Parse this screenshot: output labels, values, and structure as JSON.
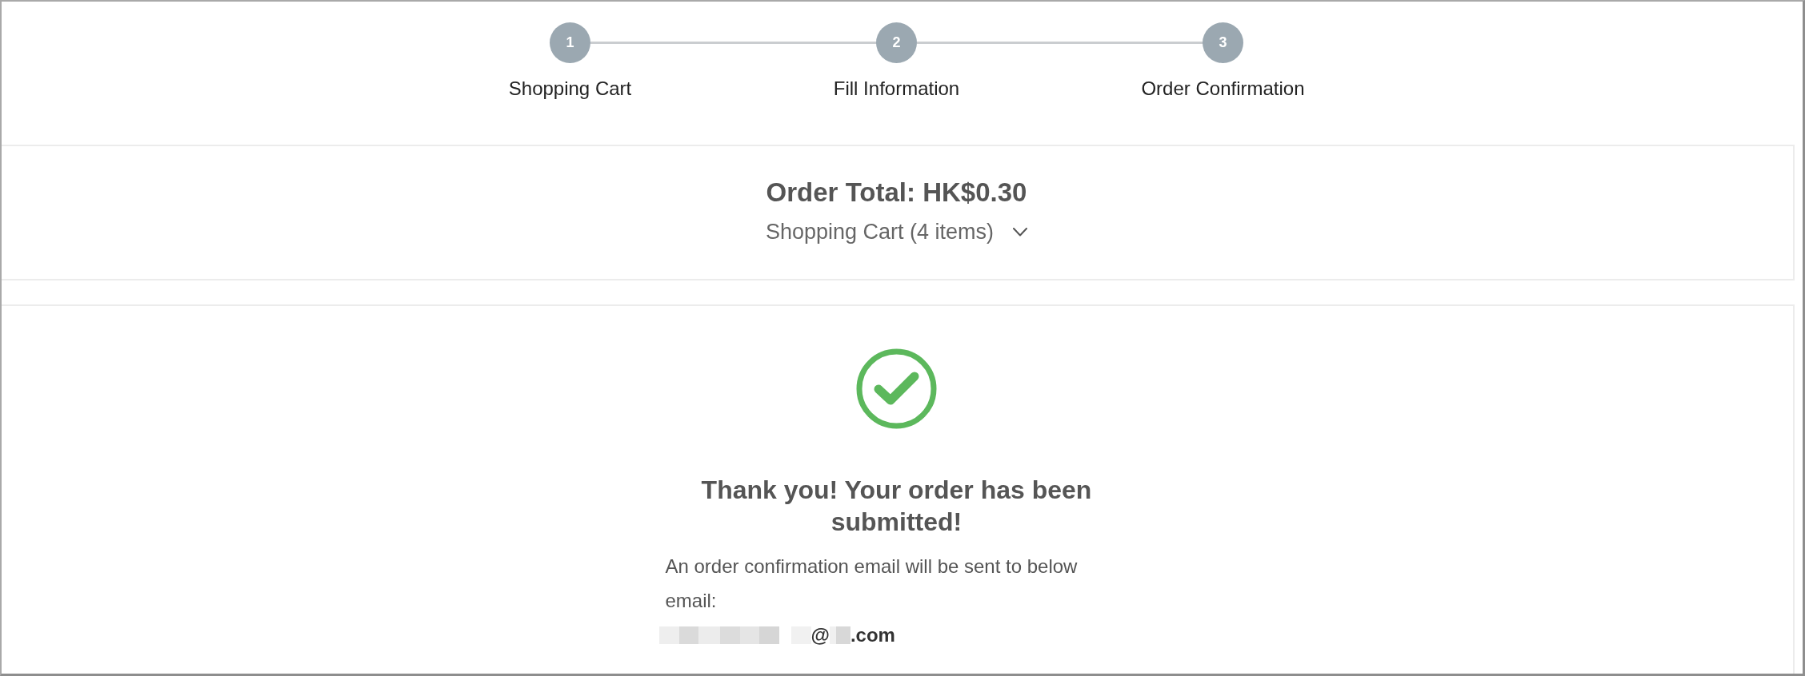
{
  "steps": [
    {
      "number": "1",
      "label": "Shopping Cart"
    },
    {
      "number": "2",
      "label": "Fill Information"
    },
    {
      "number": "3",
      "label": "Order Confirmation"
    }
  ],
  "order_summary": {
    "total": "Order Total: HK$0.30",
    "cart_toggle": "Shopping Cart (4 items)",
    "expanded": false
  },
  "confirmation": {
    "heading": "Thank you! Your order has been submitted!",
    "message": "An order confirmation email will be sent to below email:",
    "email": [
      {
        "kind": "redacted"
      },
      {
        "kind": "text",
        "text": "@"
      },
      {
        "kind": "redacted"
      },
      {
        "kind": "text",
        "text": ".com"
      }
    ]
  }
}
